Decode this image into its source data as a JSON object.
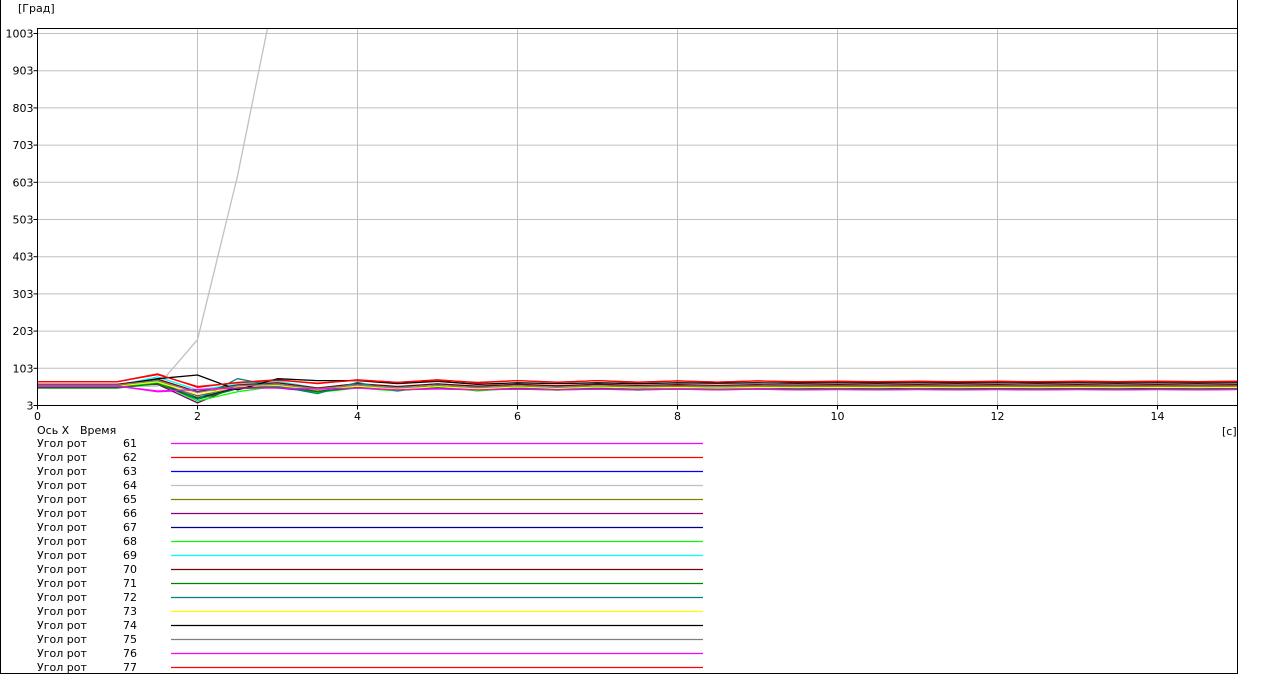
{
  "chart_data": {
    "type": "line",
    "ylabel": "[Град]",
    "xlabel": "[c]",
    "xlim": [
      0,
      15
    ],
    "ylim": [
      3,
      1003
    ],
    "grid": true,
    "y_ticks": [
      3,
      103,
      203,
      303,
      403,
      503,
      603,
      703,
      803,
      903,
      1003
    ],
    "x_ticks": [
      0,
      2,
      4,
      6,
      8,
      10,
      12,
      14
    ],
    "legend_header": {
      "axis": "Ось X",
      "name": "Время"
    },
    "legend_placement": "bottom-left",
    "x": [
      0,
      0.5,
      1,
      1.5,
      2,
      2.5,
      3,
      3.5,
      4,
      4.5,
      5,
      5.5,
      6,
      6.5,
      7,
      7.5,
      8,
      8.5,
      9,
      9.5,
      10,
      10.5,
      11,
      11.5,
      12,
      12.5,
      13,
      13.5,
      14,
      14.5,
      15
    ],
    "series": [
      {
        "name": "Угол рот",
        "id": "61",
        "color": "#ff00ff",
        "values": [
          55,
          55,
          55,
          40,
          45,
          50,
          50,
          48,
          50,
          45,
          48,
          45,
          47,
          45,
          47,
          45,
          47,
          45,
          47,
          45,
          46,
          45,
          46,
          45,
          46,
          45,
          46,
          45,
          46,
          45,
          46
        ]
      },
      {
        "name": "Угол рот",
        "id": "62",
        "color": "#ff0000",
        "values": [
          67,
          67,
          67,
          88,
          52,
          65,
          72,
          62,
          72,
          65,
          72,
          64,
          70,
          65,
          70,
          65,
          69,
          66,
          69,
          66,
          68,
          66,
          68,
          66,
          68,
          66,
          68,
          67,
          68,
          67,
          68
        ]
      },
      {
        "name": "Угол рот",
        "id": "63",
        "color": "#0000ff",
        "values": [
          55,
          55,
          55,
          68,
          30,
          55,
          58,
          44,
          56,
          46,
          55,
          47,
          54,
          48,
          53,
          49,
          53,
          50,
          53,
          50,
          52,
          51,
          52,
          51,
          52,
          51,
          52,
          51,
          52,
          51,
          52
        ]
      },
      {
        "name": "Угол рот",
        "id": "64",
        "color": "#c0c0c0",
        "values": [
          55,
          55,
          55,
          55,
          180,
          620,
          1150,
          null,
          null,
          null,
          null,
          null,
          null,
          null,
          null,
          null,
          null,
          null,
          null,
          null,
          null,
          null,
          null,
          null,
          null,
          null,
          null,
          null,
          null,
          null,
          null
        ]
      },
      {
        "name": "Угол рот",
        "id": "65",
        "color": "#808000",
        "values": [
          53,
          53,
          53,
          66,
          25,
          52,
          56,
          42,
          54,
          45,
          53,
          46,
          52,
          47,
          52,
          48,
          51,
          48,
          51,
          49,
          50,
          49,
          50,
          49,
          50,
          49,
          50,
          49,
          50,
          49,
          50
        ]
      },
      {
        "name": "Угол рот",
        "id": "66",
        "color": "#800080",
        "values": [
          57,
          57,
          57,
          60,
          10,
          55,
          50,
          40,
          55,
          45,
          52,
          45,
          50,
          46,
          50,
          46,
          49,
          47,
          49,
          47,
          48,
          47,
          48,
          47,
          48,
          47,
          48,
          47,
          48,
          47,
          48
        ]
      },
      {
        "name": "Угол рот",
        "id": "67",
        "color": "#000080",
        "values": [
          52,
          52,
          52,
          64,
          22,
          50,
          54,
          40,
          52,
          44,
          51,
          45,
          50,
          46,
          50,
          47,
          49,
          47,
          49,
          48,
          49,
          48,
          49,
          48,
          49,
          48,
          49,
          48,
          49,
          48,
          49
        ]
      },
      {
        "name": "Угол рот",
        "id": "68",
        "color": "#00ff00",
        "values": [
          50,
          50,
          50,
          65,
          15,
          40,
          55,
          38,
          50,
          42,
          55,
          42,
          50,
          44,
          52,
          44,
          50,
          45,
          50,
          45,
          49,
          45,
          49,
          45,
          48,
          46,
          48,
          46,
          48,
          46,
          48
        ]
      },
      {
        "name": "Угол рот",
        "id": "69",
        "color": "#00ffff",
        "values": [
          57,
          57,
          57,
          80,
          45,
          60,
          68,
          50,
          62,
          52,
          62,
          52,
          60,
          54,
          60,
          54,
          58,
          55,
          58,
          55,
          57,
          56,
          57,
          56,
          57,
          56,
          57,
          56,
          57,
          56,
          57
        ]
      },
      {
        "name": "Угол рот",
        "id": "70",
        "color": "#800000",
        "values": [
          60,
          60,
          60,
          74,
          40,
          58,
          64,
          50,
          62,
          54,
          61,
          55,
          60,
          56,
          60,
          57,
          59,
          57,
          59,
          58,
          59,
          58,
          59,
          58,
          59,
          58,
          59,
          58,
          59,
          58,
          59
        ]
      },
      {
        "name": "Угол рот",
        "id": "71",
        "color": "#008000",
        "values": [
          50,
          50,
          50,
          62,
          20,
          48,
          53,
          40,
          51,
          44,
          50,
          45,
          49,
          46,
          49,
          46,
          48,
          47,
          48,
          47,
          48,
          47,
          48,
          47,
          48,
          47,
          48,
          47,
          48,
          47,
          48
        ]
      },
      {
        "name": "Угол рот",
        "id": "72",
        "color": "#008080",
        "values": [
          57,
          57,
          57,
          72,
          20,
          75,
          55,
          35,
          65,
          42,
          58,
          45,
          56,
          48,
          55,
          50,
          55,
          50,
          54,
          51,
          54,
          52,
          54,
          52,
          54,
          52,
          54,
          53,
          54,
          53,
          54
        ]
      },
      {
        "name": "Угол рот",
        "id": "73",
        "color": "#ffff00",
        "values": [
          55,
          55,
          55,
          67,
          32,
          54,
          57,
          45,
          55,
          47,
          54,
          48,
          53,
          49,
          53,
          50,
          52,
          50,
          52,
          51,
          52,
          51,
          52,
          51,
          52,
          51,
          52,
          51,
          52,
          51,
          52
        ]
      },
      {
        "name": "Угол рот",
        "id": "74",
        "color": "#000000",
        "values": [
          57,
          57,
          57,
          75,
          85,
          45,
          75,
          70,
          70,
          62,
          68,
          60,
          64,
          62,
          64,
          62,
          64,
          63,
          64,
          63,
          64,
          63,
          64,
          63,
          64,
          63,
          64,
          63,
          64,
          63,
          64
        ]
      },
      {
        "name": "Угол рот",
        "id": "75",
        "color": "#808080",
        "values": [
          58,
          58,
          58,
          70,
          38,
          56,
          60,
          48,
          58,
          50,
          57,
          51,
          56,
          52,
          56,
          53,
          55,
          53,
          55,
          54,
          55,
          54,
          55,
          54,
          55,
          54,
          55,
          54,
          55,
          54,
          55
        ]
      },
      {
        "name": "Угол рот",
        "id": "76",
        "color": "#ff00ff",
        "values": [
          55,
          55,
          55,
          42,
          46,
          50,
          50,
          47,
          50,
          45,
          48,
          45,
          47,
          45,
          47,
          45,
          47,
          45,
          47,
          45,
          46,
          45,
          46,
          45,
          46,
          45,
          46,
          45,
          46,
          45,
          46
        ]
      },
      {
        "name": "Угол рот",
        "id": "77",
        "color": "#ff0000",
        "values": [
          67,
          67,
          67,
          86,
          54,
          64,
          71,
          63,
          71,
          65,
          71,
          65,
          70,
          66,
          70,
          66,
          69,
          66,
          69,
          67,
          68,
          67,
          68,
          67,
          68,
          67,
          68,
          67,
          68,
          67,
          68
        ]
      }
    ]
  }
}
